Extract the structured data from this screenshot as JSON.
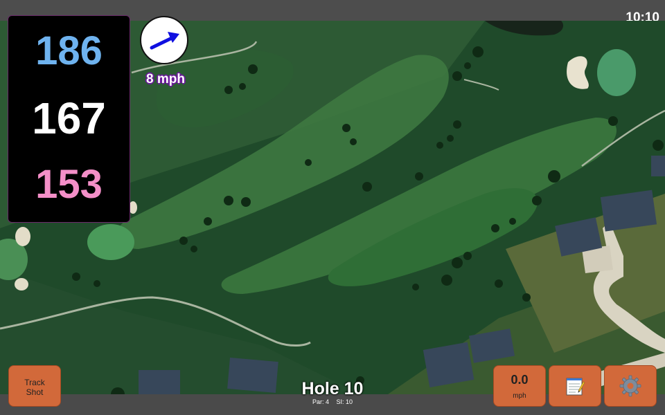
{
  "status": {
    "time": "10:10"
  },
  "distances": {
    "back": "186",
    "middle": "167",
    "front": "153",
    "colors": {
      "back": "#6fb3ef",
      "middle": "#ffffff",
      "front": "#f48fc8"
    }
  },
  "wind": {
    "speed_label": "8 mph",
    "arrow_color": "#1010e0",
    "icon": "wind-arrow-icon"
  },
  "hole": {
    "title": "Hole 10",
    "par": "Par: 4",
    "si": "SI: 10"
  },
  "buttons": {
    "track_shot": {
      "line1": "Track",
      "line2": "Shot"
    },
    "speed": {
      "value": "0.0",
      "unit": "mph"
    },
    "notes_icon": "notepad-icon",
    "settings_icon": "gear-icon",
    "color": "#d2693a"
  }
}
